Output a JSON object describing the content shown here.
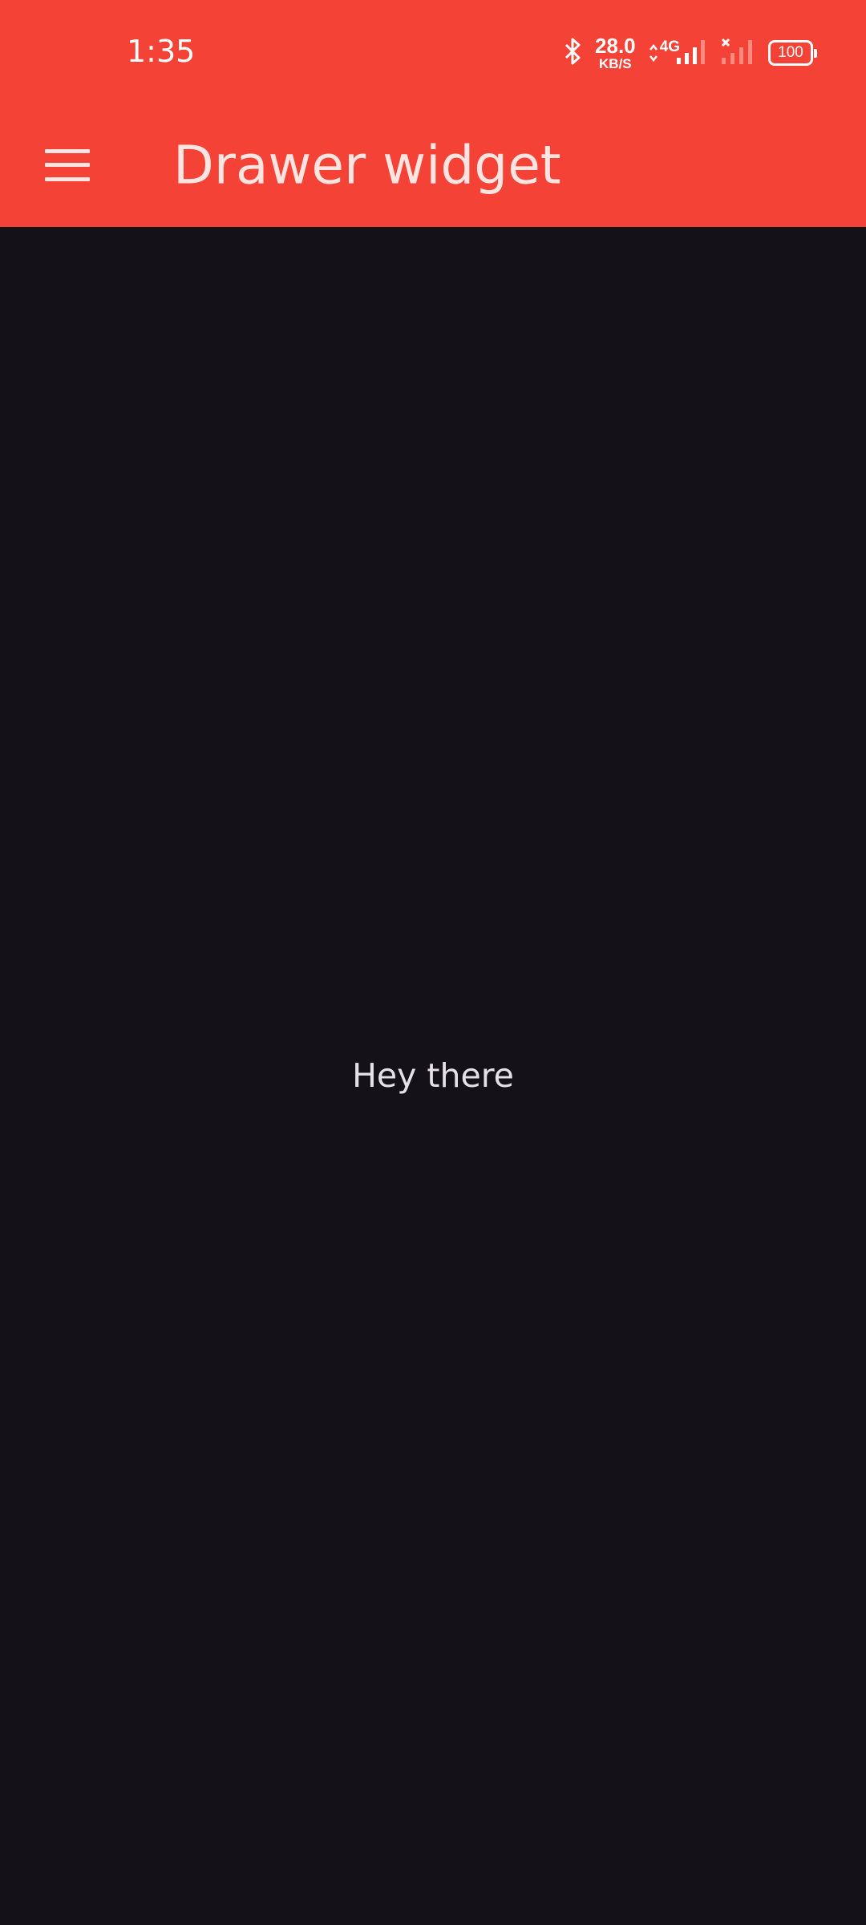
{
  "status_bar": {
    "time": "1:35",
    "net_speed_value": "28.0",
    "net_speed_unit": "KB/S",
    "network_type": "4G",
    "battery": "100",
    "icons": [
      "bluetooth-icon",
      "data-arrows-icon",
      "signal-icon",
      "no-sim-signal-icon",
      "battery-icon"
    ]
  },
  "app_bar": {
    "title": "Drawer widget",
    "menu_icon": "hamburger-menu-icon",
    "background_color": "#F44336",
    "foreground_color": "#FFE4E1"
  },
  "content": {
    "text": "Hey there",
    "background_color": "#141218"
  }
}
